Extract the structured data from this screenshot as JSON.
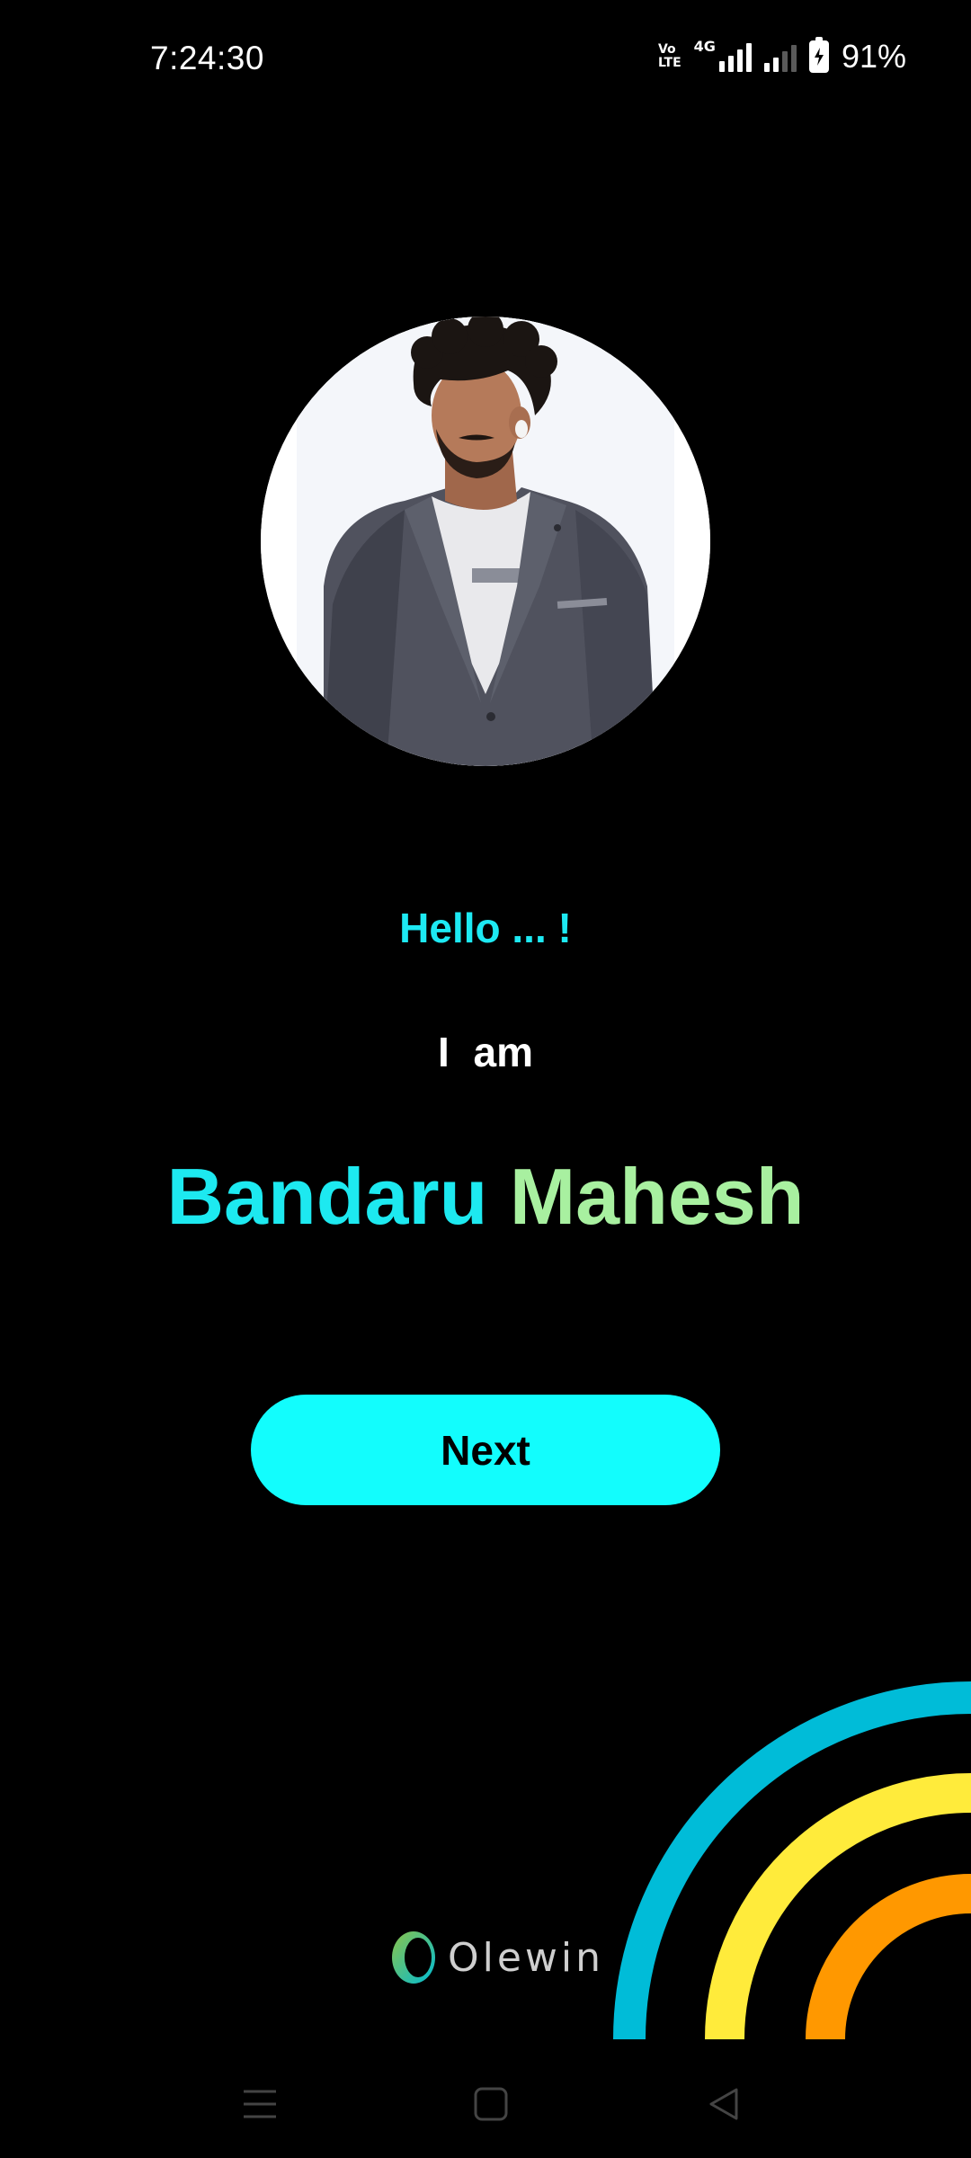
{
  "status_bar": {
    "time": "7:24:30",
    "volte_line1": "Vo",
    "volte_line2": "LTE",
    "network": "4G",
    "battery_percent": "91%"
  },
  "profile": {
    "greeting": "Hello ... !",
    "intro": "I  am",
    "first_name": "Bandaru",
    "last_name": "Mahesh"
  },
  "actions": {
    "next_label": "Next"
  },
  "branding": {
    "logo_text": "Olewin"
  },
  "colors": {
    "background": "#000000",
    "greeting": "#1de9f3",
    "name_first": "#1de9f0",
    "name_last": "#a8f0a0",
    "button": "#12fdfd",
    "arc_outer": "#00bcd8",
    "arc_middle": "#ffeb3b",
    "arc_inner": "#ff9800"
  },
  "navigation": {
    "icons": [
      "menu-icon",
      "home-icon",
      "back-icon"
    ]
  }
}
